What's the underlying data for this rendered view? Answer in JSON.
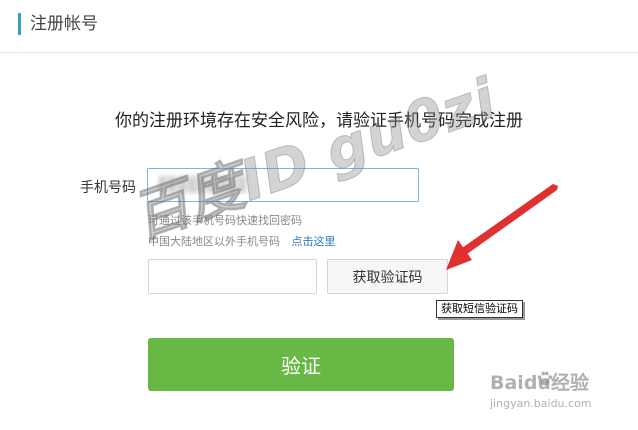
{
  "header": {
    "title": "注册帐号"
  },
  "main": {
    "warning": "你的注册环境存在安全风险，请验证手机号码完成注册",
    "phone": {
      "label": "手机号码",
      "value": ""
    },
    "hints": {
      "line1": "可通过该手机号码快速找回密码",
      "line2": "中国大陆地区以外手机号码",
      "link": "点击这里"
    },
    "code": {
      "value": "",
      "button_label": "获取验证码",
      "tooltip": "获取短信验证码"
    },
    "verify_label": "验证"
  },
  "overlay": {
    "watermark": "百度ID gu0zi",
    "brand_text": "Baidu经验",
    "brand_site": "jingyan.baidu.com"
  },
  "colors": {
    "accent": "#3aa1c5",
    "primary_button": "#67b845",
    "link": "#2b7cc0",
    "arrow": "#e03030",
    "input_focus_border": "#7ab4e3"
  }
}
